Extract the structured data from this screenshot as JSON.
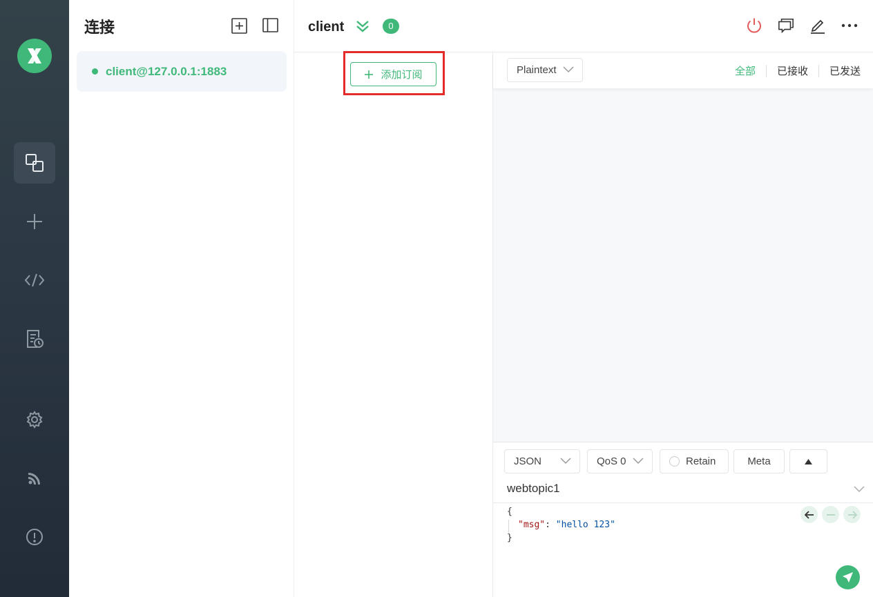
{
  "connections_panel": {
    "title": "连接",
    "items": [
      {
        "label": "client@127.0.0.1:1883",
        "status_color": "#3fb879"
      }
    ]
  },
  "header": {
    "client_name": "client",
    "subscription_count": "0"
  },
  "subscriptions": {
    "add_button_label": "添加订阅"
  },
  "messages": {
    "payload_format": "Plaintext",
    "filters": [
      "全部",
      "已接收",
      "已发送"
    ],
    "active_filter": "全部"
  },
  "publish": {
    "payload_type": "JSON",
    "qos": "QoS 0",
    "retain_label": "Retain",
    "meta_label": "Meta",
    "topic": "webtopic1",
    "payload_lines": {
      "open": "{",
      "key": "\"msg\"",
      "colon": ": ",
      "value": "\"hello 123\"",
      "close": "}"
    }
  },
  "colors": {
    "accent": "#3fb879",
    "disconnect_icon": "#e05a5a",
    "highlight_box": "#e52a2a"
  },
  "icons": {
    "rail": [
      "logo-icon",
      "connections-icon",
      "new-connection-icon",
      "script-icon",
      "log-icon",
      "settings-icon",
      "feed-icon",
      "about-icon"
    ],
    "header": [
      "disconnect-icon",
      "chat-icon",
      "edit-icon",
      "more-icon"
    ]
  }
}
